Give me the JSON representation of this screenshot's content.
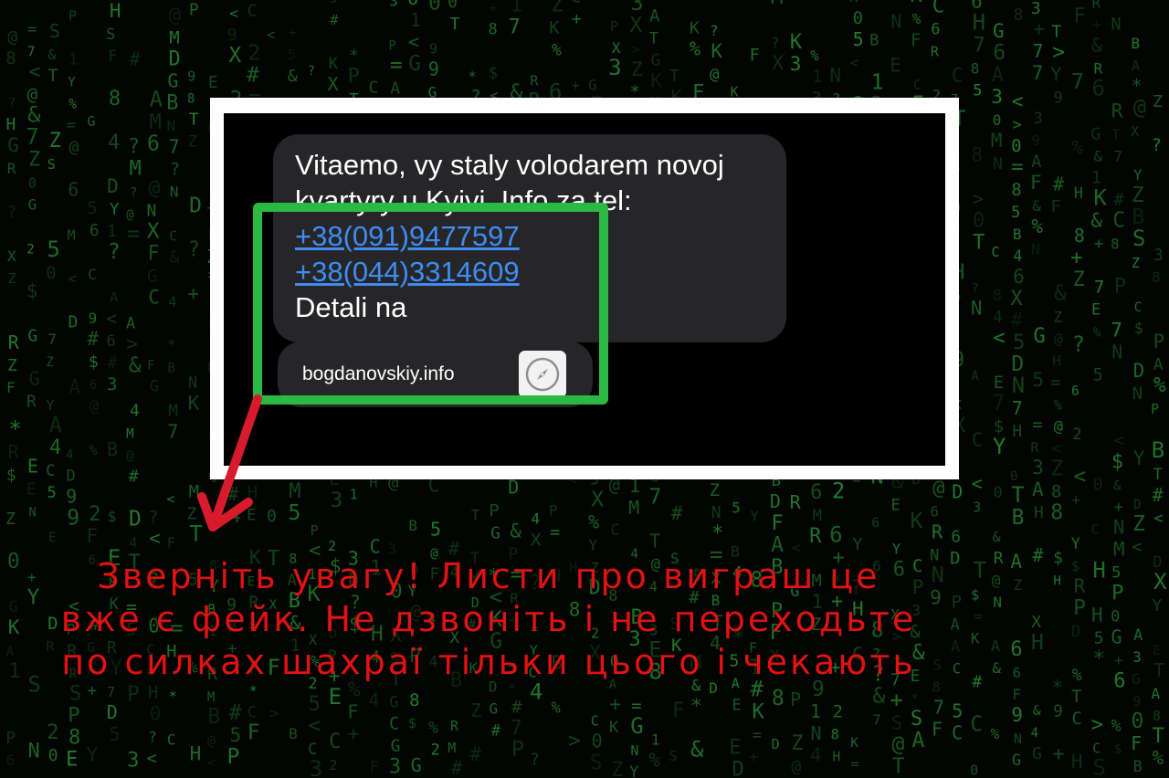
{
  "message": {
    "lines": [
      "Vitaemo, vy staly volodarem novoj",
      "kvartyry u Kyivi. Info za tel:"
    ],
    "phone_links": [
      "+38(091)9477597",
      "+38(044)3314609"
    ],
    "detail_text": "Detali na"
  },
  "link_preview": {
    "domain": "bogdanovskiy.info",
    "icon": "safari-compass-icon"
  },
  "warning": {
    "lines": [
      "Зверніть увагу! Листи про виграш це",
      "вже є фейк. Не дзвоніть і не переходьте",
      "по силках шахраї тільки цього і чекають"
    ]
  },
  "colors": {
    "highlight": "#2aba44",
    "arrow": "#d81b2c",
    "warning_text": "#e21212",
    "link": "#3f8cf2",
    "bubble": "#262628",
    "matrix_glyph": "#2fae3f"
  }
}
